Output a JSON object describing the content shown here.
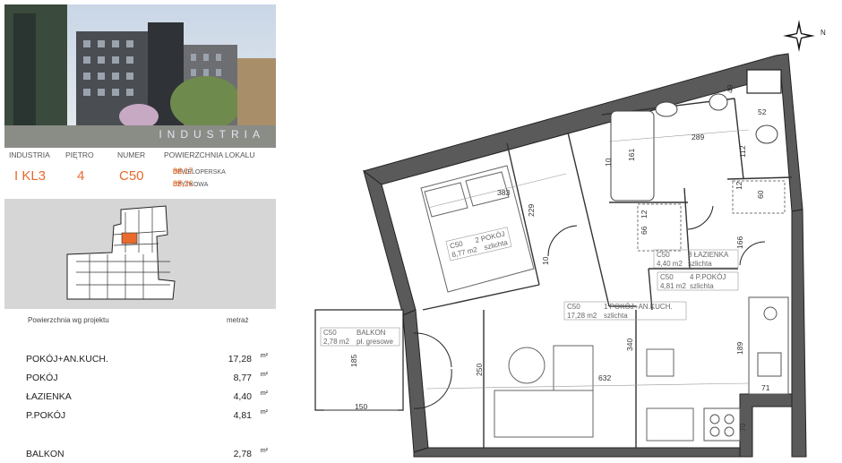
{
  "photo": {
    "brand": "INDUSTRIA"
  },
  "info": {
    "headers": {
      "investment": "INDUSTRIA",
      "floor": "PIĘTRO",
      "number": "NUMER",
      "area": "POWIERZCHNIA LOKALU"
    },
    "values": {
      "investment": "I KL3",
      "floor": "4",
      "number": "C50"
    },
    "area_developer": {
      "value": "36,17",
      "unit": "m²",
      "label": "DEWELOPERSKA"
    },
    "area_usable": {
      "value": "35,26",
      "unit": "m²",
      "label": "UŻYTKOWA"
    }
  },
  "table": {
    "header_left": "Powierzchnia wg projektu",
    "header_right": "metraż",
    "rows": [
      {
        "name": "POKÓJ+AN.KUCH.",
        "value": "17,28",
        "unit": "m²"
      },
      {
        "name": "POKÓJ",
        "value": "8,77",
        "unit": "m²"
      },
      {
        "name": "ŁAZIENKA",
        "value": "4,40",
        "unit": "m²"
      },
      {
        "name": "P.POKÓJ",
        "value": "4,81",
        "unit": "m²"
      }
    ],
    "balcony": {
      "name": "BALKON",
      "value": "2,78",
      "unit": "m²"
    }
  },
  "compass": {
    "north": "N"
  },
  "plan": {
    "rooms": [
      {
        "code": "C50",
        "name": "2 POKÓJ",
        "area": "8,77 m2",
        "finish": "szlichta"
      },
      {
        "code": "C50",
        "name": "3 ŁAZIENKA",
        "area": "4,40 m2",
        "finish": "szlichta"
      },
      {
        "code": "C50",
        "name": "4 P.POKÓJ",
        "area": "4,81 m2",
        "finish": "szlichta"
      },
      {
        "code": "C50",
        "name": "1 POKÓJ+AN.KUCH.",
        "area": "17,28 m2",
        "finish": "szlichta"
      },
      {
        "code": "C50",
        "name": "BALKON",
        "area": "2,78 m2",
        "finish": "pł. gresowe"
      }
    ],
    "dims": [
      "383",
      "229",
      "10",
      "161",
      "289",
      "10",
      "112",
      "52",
      "49",
      "12",
      "66",
      "12",
      "60",
      "166",
      "340",
      "632",
      "250",
      "189",
      "71",
      "70",
      "185",
      "150"
    ]
  }
}
